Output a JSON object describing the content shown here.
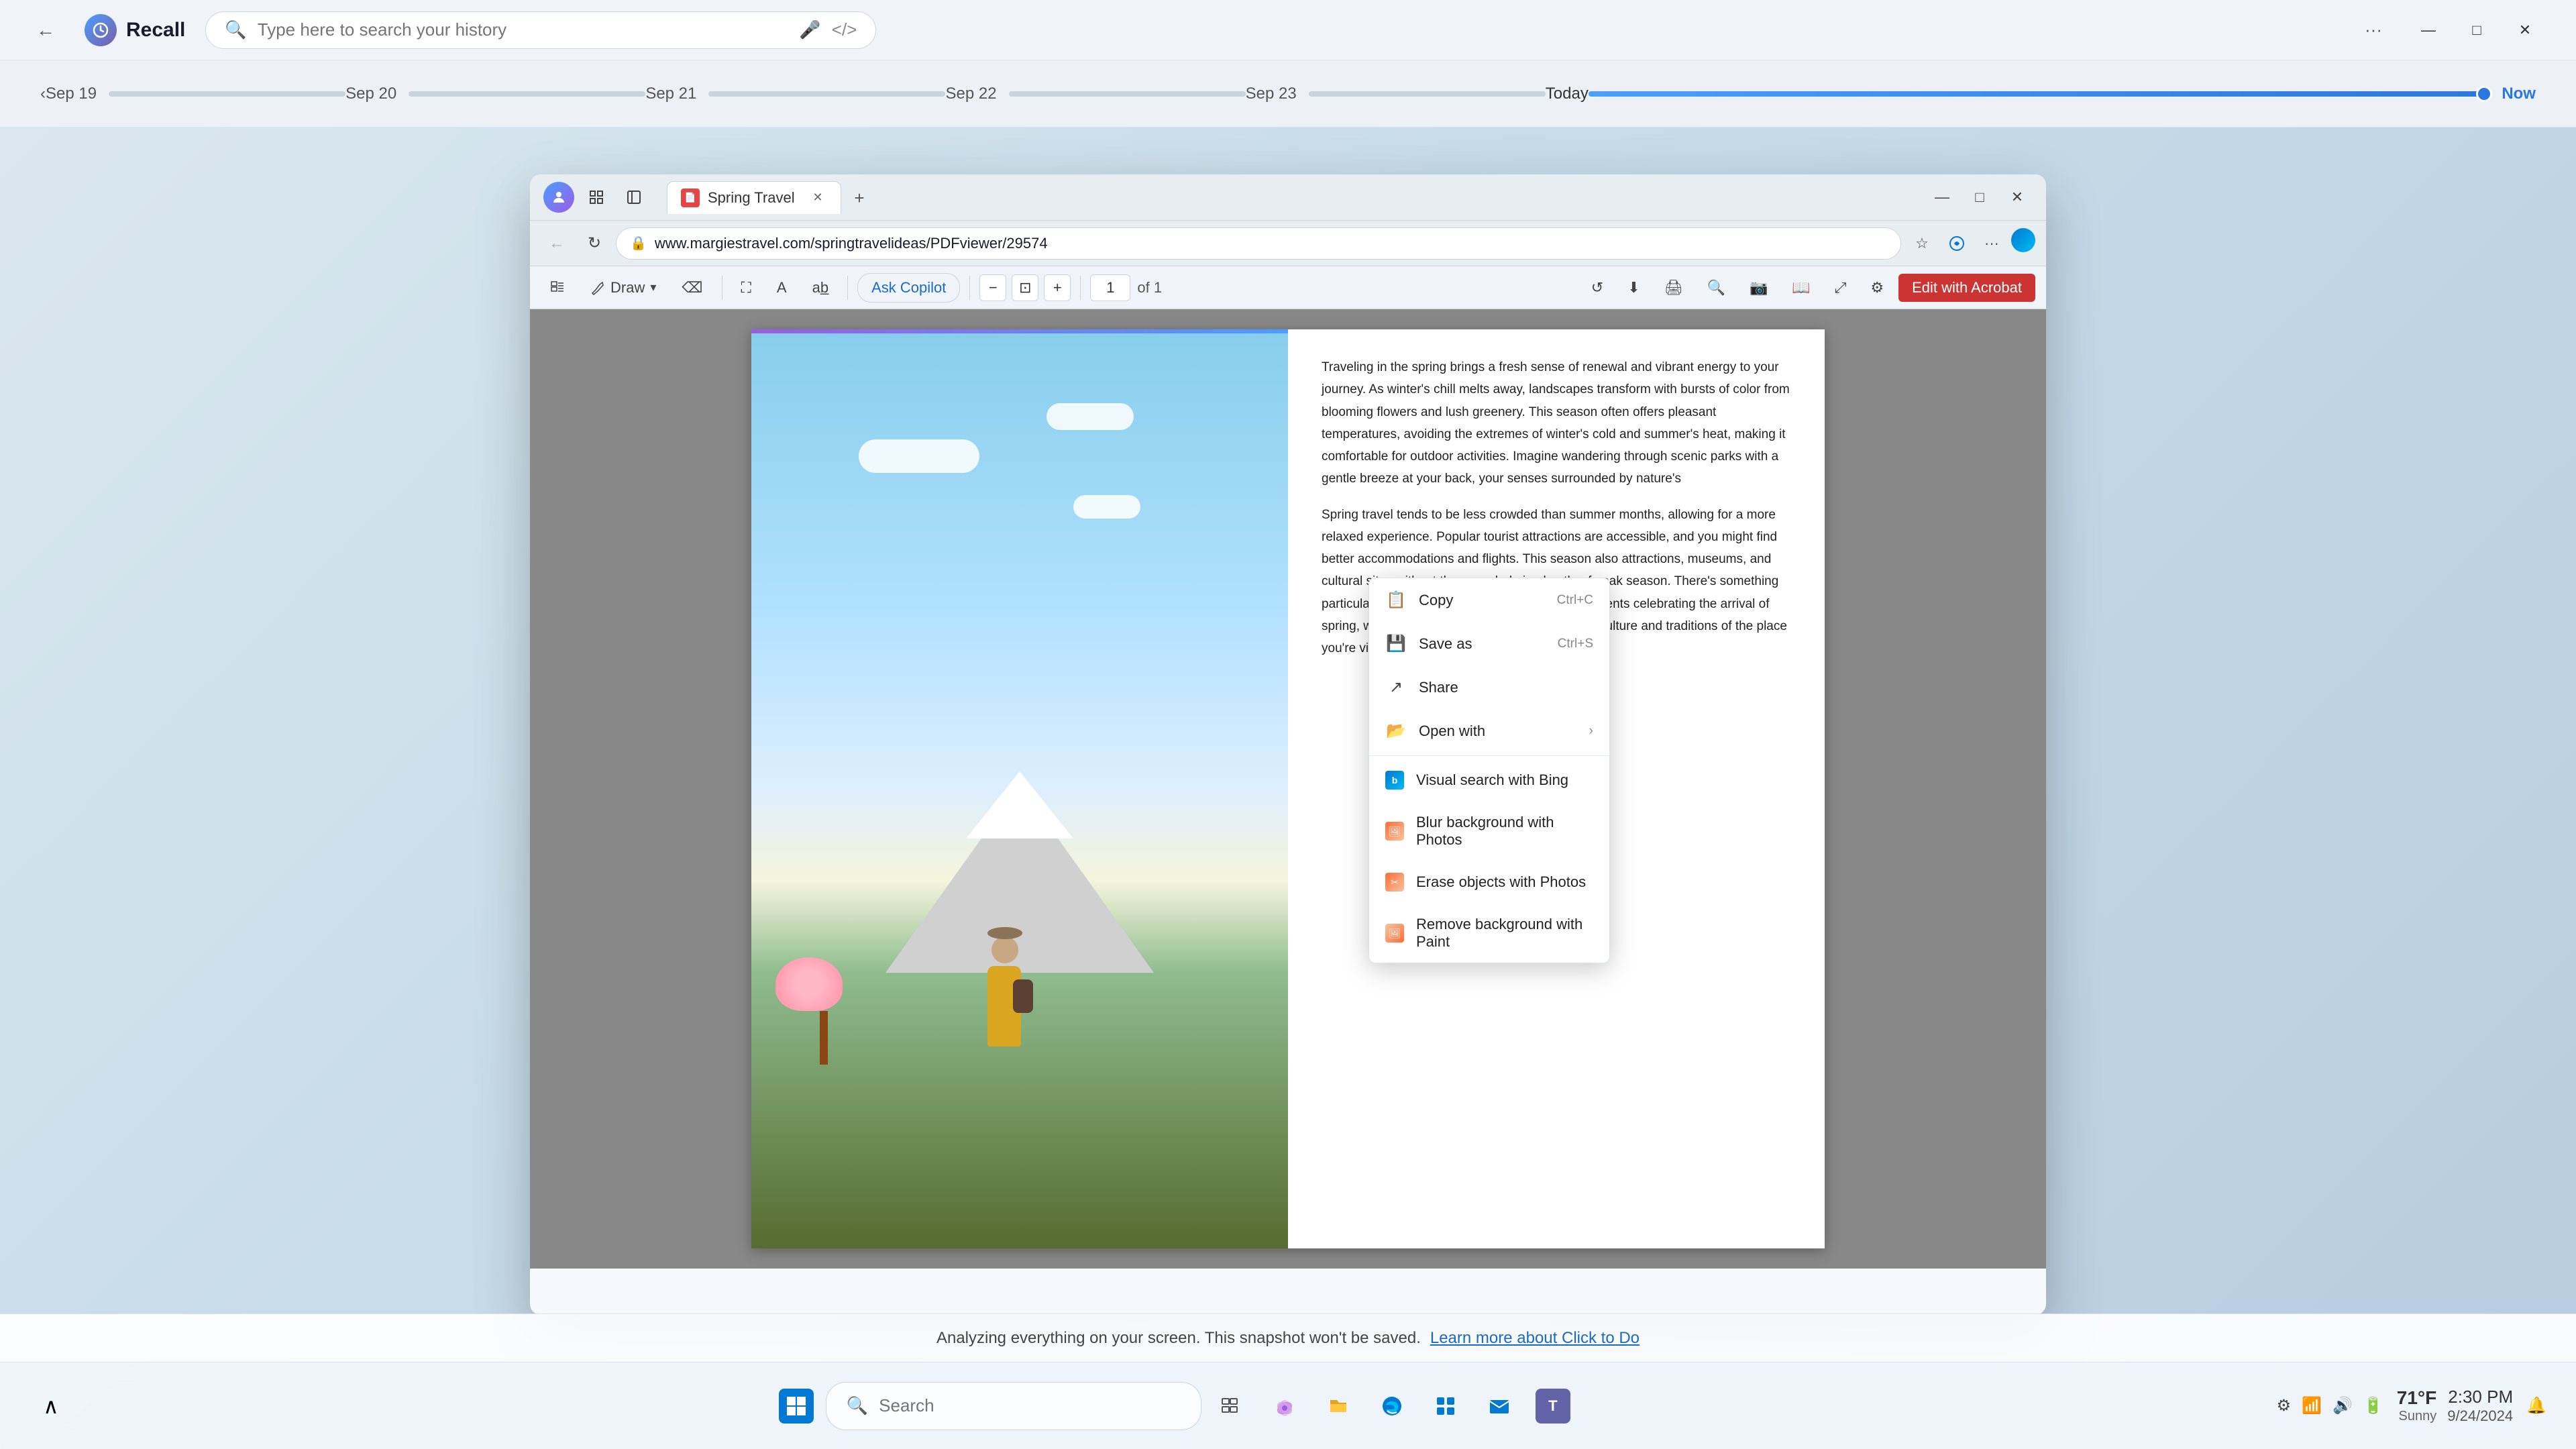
{
  "recall": {
    "title": "Recall",
    "search_placeholder": "Type here to search your history",
    "back_label": "←",
    "reload_label": "↻"
  },
  "timeline": {
    "segments": [
      {
        "label": "Sep 19",
        "active": false
      },
      {
        "label": "Sep 20",
        "active": false
      },
      {
        "label": "Sep 21",
        "active": false
      },
      {
        "label": "Sep 22",
        "active": false
      },
      {
        "label": "Sep 23",
        "active": false
      },
      {
        "label": "Today",
        "active": true
      }
    ],
    "now_label": "Now"
  },
  "browser": {
    "tab": {
      "title": "Spring Travel",
      "favicon": "📄"
    },
    "url": "www.margiestravel.com/springtravelideas/PDFviewer/29574",
    "pdf": {
      "page_current": "1",
      "page_total": "of 1",
      "copilot_label": "Ask Copilot",
      "edit_acrobat_label": "Edit with Acrobat"
    },
    "content": {
      "paragraph1": "Traveling in the spring brings a fresh sense of renewal and vibrant energy to your journey. As winter's chill melts away, landscapes transform with bursts of color from blooming flowers and lush greenery. This season often offers pleasant temperatures, avoiding the extremes of winter's cold and summer's heat, making it comfortable for outdoor activities. Imagine wandering through scenic parks with a gentle breeze at your back, your senses surrounded by nature's",
      "paragraph2": "Spring travel tends to be less crowded than summer months, allowing for a more relaxed experience. Popular tourist attractions are accessible, and you might find better accommodations and flights. This season also attractions, museums, and cultural sites without the overwhelming hustle of peak season. There's something particularly enchanting about local festivals and events celebrating the arrival of spring, which provide a deeper connection to the culture and traditions of the place you're visiting."
    }
  },
  "context_menu": {
    "items": [
      {
        "id": "copy",
        "icon": "📋",
        "label": "Copy",
        "shortcut": "Ctrl+C",
        "arrow": ""
      },
      {
        "id": "save_as",
        "icon": "💾",
        "label": "Save as",
        "shortcut": "Ctrl+S",
        "arrow": ""
      },
      {
        "id": "share",
        "icon": "↗",
        "label": "Share",
        "shortcut": "",
        "arrow": ""
      },
      {
        "id": "open_with",
        "icon": "📂",
        "label": "Open with",
        "shortcut": "",
        "arrow": "›"
      },
      {
        "id": "visual_search",
        "icon": "B",
        "label": "Visual search with Bing",
        "shortcut": "",
        "arrow": "",
        "type": "bing"
      },
      {
        "id": "blur_background",
        "icon": "🖼",
        "label": "Blur background with Photos",
        "shortcut": "",
        "arrow": "",
        "type": "photos"
      },
      {
        "id": "erase_objects",
        "icon": "✂",
        "label": "Erase objects with Photos",
        "shortcut": "",
        "arrow": "",
        "type": "photos"
      },
      {
        "id": "remove_background",
        "icon": "🖼",
        "label": "Remove background with Paint",
        "shortcut": "",
        "arrow": "",
        "type": "paint"
      }
    ]
  },
  "notification": {
    "text": "Analyzing everything on your screen. This snapshot won't be saved.",
    "link_text": "Learn more about Click to Do"
  },
  "taskbar": {
    "search_label": "Search",
    "search_placeholder": "Search",
    "weather": {
      "temp": "71°F",
      "condition": "Sunny"
    },
    "clock": {
      "time": "2:30 PM",
      "date": "9/24/2024"
    },
    "apps": [
      {
        "id": "start",
        "icon": "⊞",
        "color": "#0078d4"
      },
      {
        "id": "search",
        "icon": "🔍",
        "color": "#888"
      },
      {
        "id": "taskview",
        "icon": "⊟",
        "color": "#555"
      },
      {
        "id": "files",
        "icon": "📁",
        "color": "#e8a020"
      },
      {
        "id": "edge",
        "icon": "🌐",
        "color": "#0078d4"
      },
      {
        "id": "store",
        "icon": "🛍",
        "color": "#0078d4"
      },
      {
        "id": "mail",
        "icon": "✉",
        "color": "#0078d4"
      },
      {
        "id": "teams",
        "icon": "T",
        "color": "#6264a7"
      }
    ]
  }
}
